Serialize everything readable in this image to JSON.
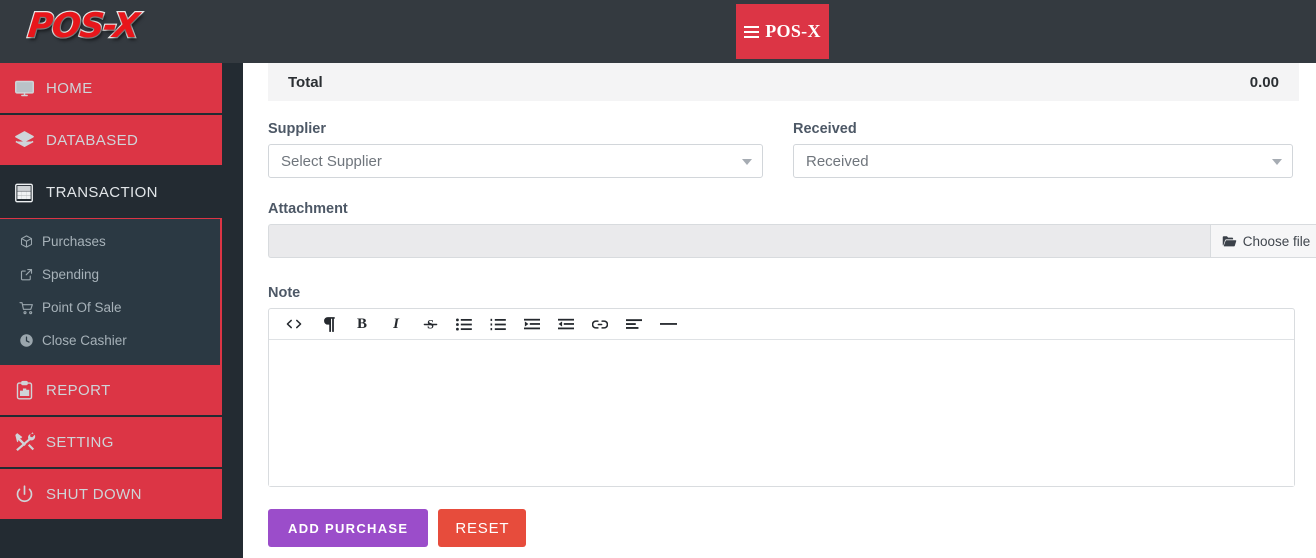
{
  "topbar": {
    "logo_text": "POS-X",
    "brand_button": {
      "label": "POS-X",
      "icon": "hamburger-menu-icon"
    }
  },
  "sidebar": {
    "items": [
      {
        "label": "HOME",
        "icon": "desktop-monitor-icon",
        "state": "red"
      },
      {
        "label": "DATABASED",
        "icon": "layers-stack-icon",
        "state": "red"
      },
      {
        "label": "TRANSACTION",
        "icon": "calculator-grid-icon",
        "state": "active-dark"
      },
      {
        "label": "REPORT",
        "icon": "clipboard-chart-icon",
        "state": "red"
      },
      {
        "label": "SETTING",
        "icon": "tools-wrench-screwdriver-icon",
        "state": "red"
      },
      {
        "label": "SHUT DOWN",
        "icon": "power-off-icon",
        "state": "red"
      }
    ],
    "submenu": [
      {
        "label": "Purchases",
        "icon": "box-cube-icon"
      },
      {
        "label": "Spending",
        "icon": "external-link-icon"
      },
      {
        "label": "Point Of Sale",
        "icon": "shopping-cart-icon"
      },
      {
        "label": "Close Cashier",
        "icon": "clock-icon"
      }
    ]
  },
  "main": {
    "total": {
      "label": "Total",
      "value": "0.00"
    },
    "supplier": {
      "label": "Supplier",
      "selected": "Select Supplier",
      "placeholder": "Select Supplier"
    },
    "received": {
      "label": "Received",
      "selected": "Received",
      "placeholder": "Received"
    },
    "attachment": {
      "label": "Attachment",
      "field_value": "",
      "button_label": "Choose file",
      "button_icon": "folder-open-icon"
    },
    "note": {
      "label": "Note",
      "content": "",
      "toolbar": [
        {
          "name": "code-view-icon",
          "glyph": "<>"
        },
        {
          "name": "paragraph-mark-icon",
          "glyph": "¶"
        },
        {
          "name": "bold-icon",
          "glyph": "B"
        },
        {
          "name": "italic-icon",
          "glyph": "I"
        },
        {
          "name": "strikethrough-icon",
          "glyph": "S"
        },
        {
          "name": "unordered-list-icon",
          "glyph": ""
        },
        {
          "name": "ordered-list-icon",
          "glyph": ""
        },
        {
          "name": "outdent-icon",
          "glyph": ""
        },
        {
          "name": "indent-icon",
          "glyph": ""
        },
        {
          "name": "link-icon",
          "glyph": ""
        },
        {
          "name": "align-left-icon",
          "glyph": ""
        },
        {
          "name": "horizontal-rule-icon",
          "glyph": ""
        }
      ]
    },
    "actions": {
      "add_purchase": "ADD PURCHASE",
      "reset": "RESET"
    }
  },
  "colors": {
    "topbar_bg": "#343a40",
    "sidebar_bg": "#232b32",
    "nav_red": "#dc3545",
    "submenu_bg": "#2b3943",
    "logo_red": "#e8161b",
    "add_purchase": "#9b4dca",
    "reset": "#e74c3c",
    "total_row_bg": "#f4f4f5"
  }
}
